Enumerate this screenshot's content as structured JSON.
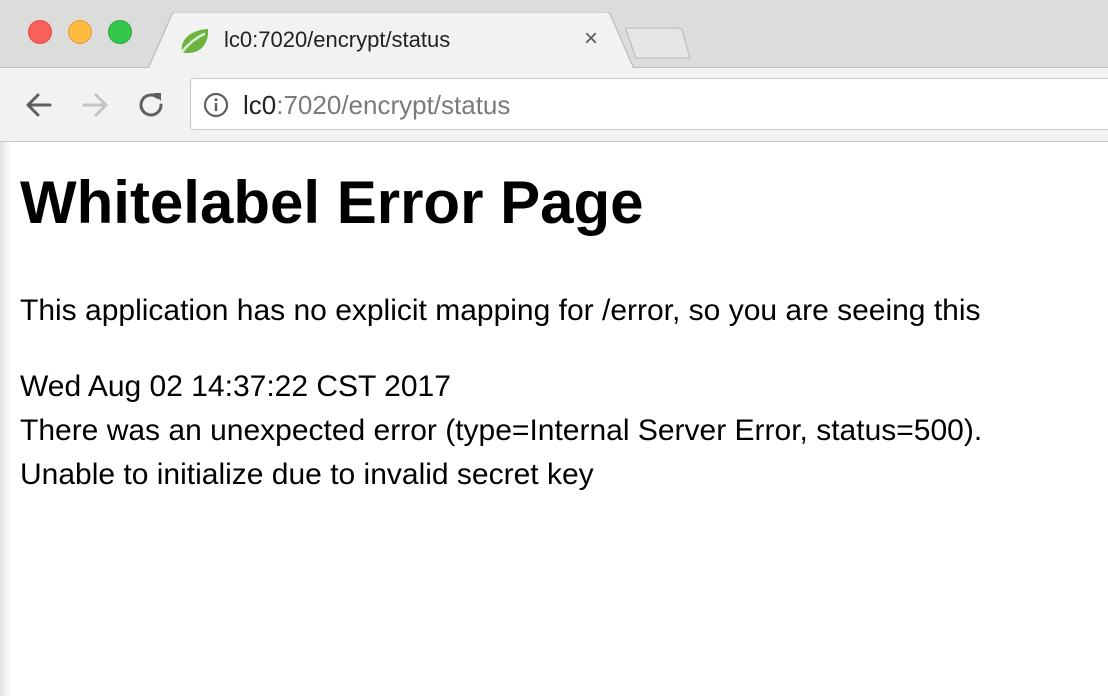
{
  "browser": {
    "tab": {
      "title": "lc0:7020/encrypt/status",
      "favicon": "spring-leaf-icon",
      "close_glyph": "×"
    },
    "address_bar": {
      "host": "lc0",
      "path": ":7020/encrypt/status",
      "security_icon": "info-icon"
    },
    "nav_icons": [
      "back-arrow-icon",
      "forward-arrow-icon",
      "reload-icon"
    ],
    "colors": {
      "close_light": "#fc605c",
      "minimize_light": "#fdbc40",
      "maximize_light": "#34c84a",
      "favicon_green": "#6db33f"
    }
  },
  "page": {
    "title": "Whitelabel Error Page",
    "message": "This application has no explicit mapping for /error, so you are seeing this",
    "timestamp": "Wed Aug 02 14:37:22 CST 2017",
    "error_detail": "There was an unexpected error (type=Internal Server Error, status=500).",
    "error_reason": "Unable to initialize due to invalid secret key"
  }
}
